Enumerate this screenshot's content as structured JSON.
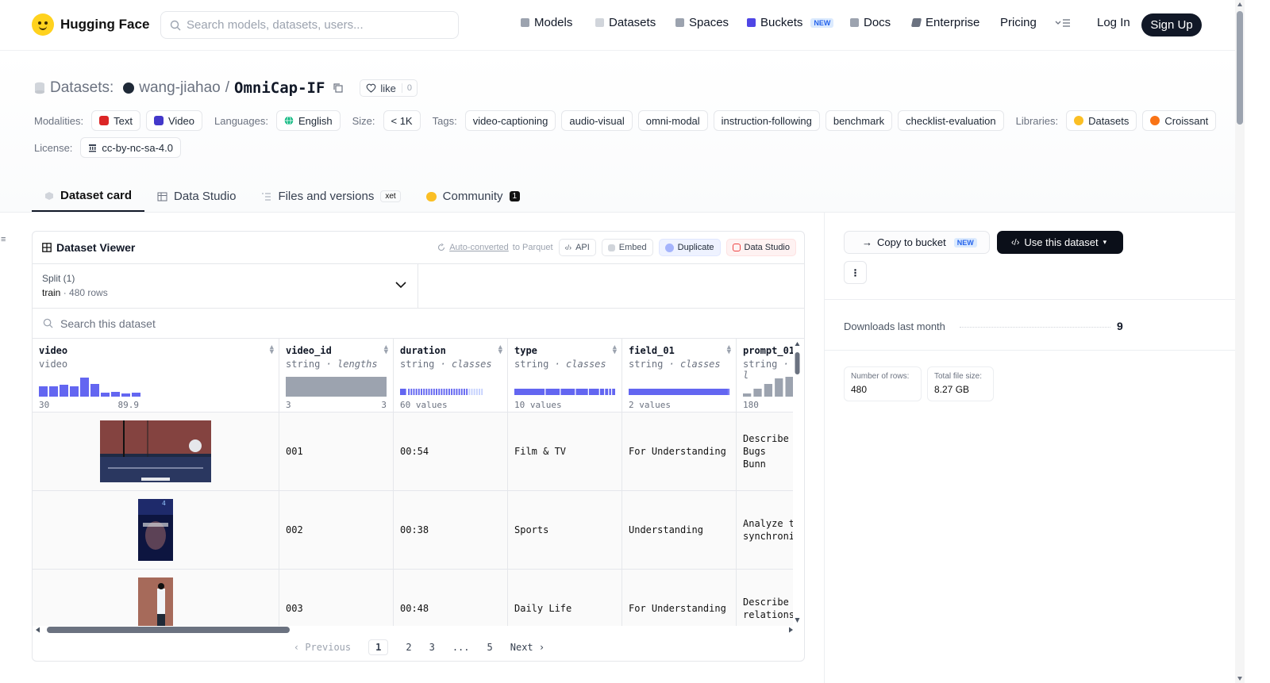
{
  "header": {
    "brand": "Hugging Face",
    "search_placeholder": "Search models, datasets, users...",
    "nav": [
      {
        "label": "Models",
        "color": "#9ca3af"
      },
      {
        "label": "Datasets",
        "color": "#d1d5db"
      },
      {
        "label": "Spaces",
        "color": "#9ca3af"
      },
      {
        "label": "Buckets",
        "color": "#4f46e5"
      },
      {
        "label": "Docs",
        "color": "#9ca3af"
      },
      {
        "label": "Enterprise",
        "color": "#6b7280"
      },
      {
        "label": "Pricing",
        "color": ""
      }
    ],
    "buckets_badge": "NEW",
    "login": "Log In",
    "signup": "Sign Up"
  },
  "repo": {
    "kind": "Datasets:",
    "owner": "wang-jiahao",
    "sep": "/",
    "name": "OmniCap-IF",
    "like_label": "like",
    "like_count": "0"
  },
  "meta": {
    "modalities_label": "Modalities:",
    "modalities": [
      "Text",
      "Video"
    ],
    "languages_label": "Languages:",
    "language": "English",
    "size_label": "Size:",
    "size": "< 1K",
    "tags_label": "Tags:",
    "tags": [
      "video-captioning",
      "audio-visual",
      "omni-modal",
      "instruction-following",
      "benchmark",
      "checklist-evaluation"
    ],
    "libraries_label": "Libraries:",
    "libraries": [
      "Datasets",
      "Croissant"
    ],
    "license_label": "License:",
    "license": "cc-by-nc-sa-4.0"
  },
  "tabs": [
    {
      "label": "Dataset card",
      "active": true
    },
    {
      "label": "Data Studio",
      "active": false
    },
    {
      "label": "Files and versions",
      "active": false,
      "badge": "xet"
    },
    {
      "label": "Community",
      "active": false,
      "badge": "1"
    }
  ],
  "viewer": {
    "title": "Dataset Viewer",
    "auto_link": "Auto-converted",
    "auto_rest": "to Parquet",
    "actions": [
      "API",
      "Embed",
      "Duplicate",
      "Data Studio"
    ],
    "split_label": "Split (1)",
    "split_name": "train",
    "split_dot": "·",
    "split_rows": "480 rows",
    "search_placeholder": "Search this dataset",
    "columns": [
      {
        "name": "video",
        "type": "video",
        "subtype": "",
        "foot_left": "30",
        "foot_right": "89.9",
        "hist": "bars"
      },
      {
        "name": "video_id",
        "type": "string",
        "subtype": "· lengths",
        "foot_left": "3",
        "foot_right": "3",
        "hist": "block"
      },
      {
        "name": "duration",
        "type": "string",
        "subtype": "· classes",
        "foot_left": "60 values",
        "foot_right": "",
        "hist": "fine"
      },
      {
        "name": "type",
        "type": "string",
        "subtype": "· classes",
        "foot_left": "10 values",
        "foot_right": "",
        "hist": "segments"
      },
      {
        "name": "field_01",
        "type": "string",
        "subtype": "· classes",
        "foot_left": "2 values",
        "foot_right": "",
        "hist": "solid"
      },
      {
        "name": "prompt_01",
        "type": "string",
        "subtype": "· l",
        "foot_left": "180",
        "foot_right": "",
        "hist": "rising"
      }
    ],
    "rows": [
      {
        "video_id": "001",
        "duration": "00:54",
        "type": "Film & TV",
        "field_01": "For Understanding",
        "prompt_01": "Describe Bugs Bunn"
      },
      {
        "video_id": "002",
        "duration": "00:38",
        "type": "Sports",
        "field_01": "Understanding",
        "prompt_01": "Analyze t synchroni"
      },
      {
        "video_id": "003",
        "duration": "00:48",
        "type": "Daily Life",
        "field_01": "For Understanding",
        "prompt_01": "Describe relations"
      }
    ],
    "pager": {
      "prev": "Previous",
      "pages": [
        "1",
        "2",
        "3",
        "...",
        "5"
      ],
      "next": "Next"
    }
  },
  "sidebar": {
    "copy_label": "Copy to bucket",
    "copy_badge": "NEW",
    "use_label": "Use this dataset",
    "downloads_label": "Downloads last month",
    "downloads_value": "9",
    "rows_label": "Number of rows:",
    "rows_value": "480",
    "size_label": "Total file size:",
    "size_value": "8.27 GB"
  },
  "colors": {
    "accent": "#6366f1",
    "dark": "#111827",
    "hist_gray": "#9ca3af"
  }
}
